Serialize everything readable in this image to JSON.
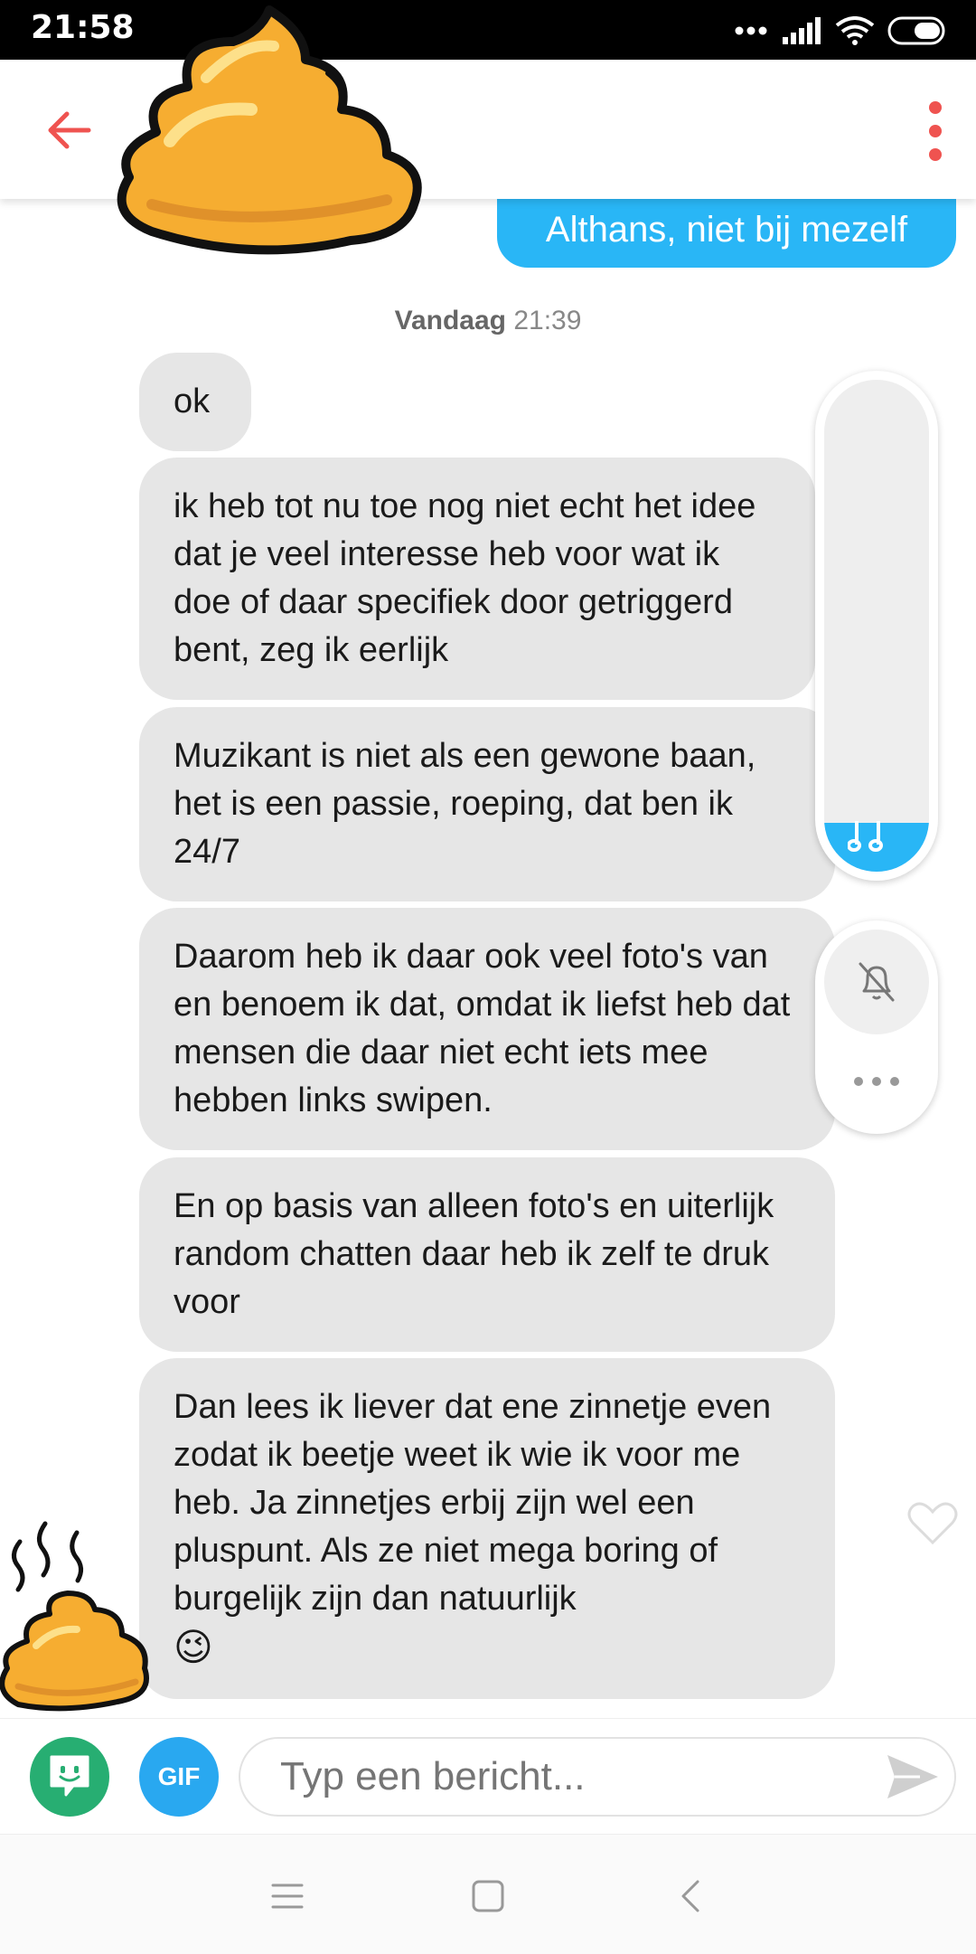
{
  "status_bar": {
    "time": "21:58"
  },
  "header": {
    "back_icon": "arrow-left-icon",
    "menu_icon": "vertical-dots-icon",
    "accent": "#ef5350"
  },
  "chat": {
    "sent_message": "Althans, niet bij mezelf",
    "timestamp_day": "Vandaag",
    "timestamp_time": "21:39",
    "received": [
      "ok",
      "ik heb tot nu toe nog niet echt het idee dat je veel interesse heb voor wat ik doe of daar specifiek door getriggerd bent, zeg ik eerlijk",
      "Muzikant is niet als een gewone baan, het is een passie, roeping, dat ben ik 24/7",
      "Daarom heb ik daar ook veel foto's van en benoem ik dat, omdat ik liefst heb dat mensen die daar niet echt iets mee hebben links swipen.",
      "En op basis van alleen foto's en uiterlijk random chatten daar heb ik zelf te druk voor",
      "Dan lees ik liever dat ene zinnetje even zodat ik beetje weet ik wie ik voor me heb. Ja zinnetjes erbij zijn wel een pluspunt. Als ze niet mega boring of burgelijk zijn dan natuurlijk"
    ],
    "last_emoji": "😉",
    "bubble_color": "#e6e6e6",
    "sent_color": "#29b6f6"
  },
  "side_controls": {
    "music_volume_fraction": 0.1,
    "music_icon": "music-note-icon",
    "mute_icon": "bell-off-icon",
    "more_icon": "horizontal-dots-icon"
  },
  "input_bar": {
    "sticker_icon": "sticker-icon",
    "gif_label": "GIF",
    "placeholder": "Typ een bericht...",
    "send_icon": "send-icon"
  },
  "nav_bar": {
    "icons": [
      "menu-icon",
      "home-square-icon",
      "back-chevron-icon"
    ]
  }
}
